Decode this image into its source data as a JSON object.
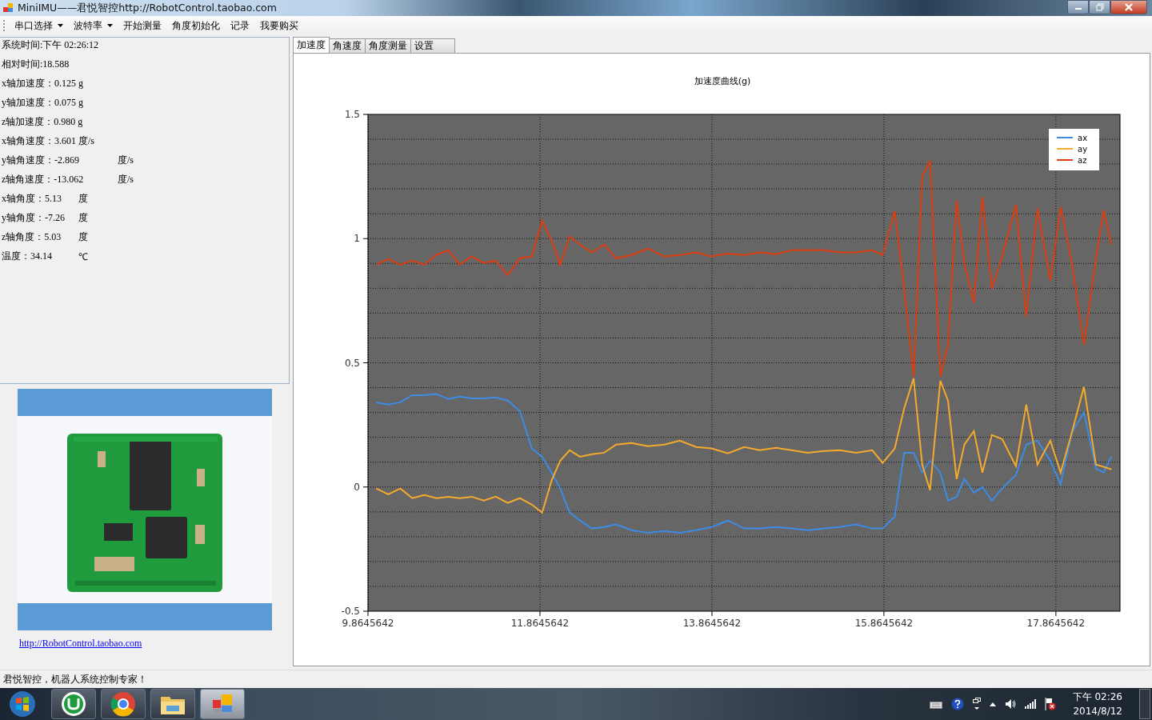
{
  "window": {
    "title": "MiniIMU——君悦智控http://RobotControl.taobao.com"
  },
  "menu": [
    {
      "label": "串口选择",
      "dropdown": true
    },
    {
      "label": "波特率",
      "dropdown": true
    },
    {
      "label": "开始测量",
      "dropdown": false
    },
    {
      "label": "角度初始化",
      "dropdown": false
    },
    {
      "label": "记录",
      "dropdown": false
    },
    {
      "label": "我要购买",
      "dropdown": false
    }
  ],
  "readings": [
    {
      "kind": "plain",
      "text": "系统时间:下午 02:26:12"
    },
    {
      "kind": "plain",
      "text": "相对时间:18.588"
    },
    {
      "kind": "plain",
      "text": "x轴加速度：0.125 g"
    },
    {
      "kind": "plain",
      "text": "y轴加速度：0.075 g"
    },
    {
      "kind": "plain",
      "text": "z轴加速度：0.980 g"
    },
    {
      "kind": "plain",
      "text": "x轴角速度：3.601 度/s"
    },
    {
      "kind": "rate",
      "text": "y轴角速度：-2.869",
      "unit": "度/s"
    },
    {
      "kind": "rate",
      "text": "z轴角速度：-13.062",
      "unit": "度/s"
    },
    {
      "kind": "angle",
      "text": "x轴角度：5.13",
      "unit": "度"
    },
    {
      "kind": "angle",
      "text": "y轴角度：-7.26",
      "unit": "度"
    },
    {
      "kind": "angle",
      "text": "z轴角度：5.03",
      "unit": "度"
    },
    {
      "kind": "angle",
      "text": "温度：34.14",
      "unit": "℃"
    }
  ],
  "link": "http://RobotControl.taobao.com",
  "tabs": [
    {
      "label": "加速度",
      "selected": true
    },
    {
      "label": "角速度",
      "selected": false
    },
    {
      "label": "角度测量",
      "selected": false
    },
    {
      "label": "设置",
      "selected": false
    }
  ],
  "chart": {
    "chart_data": {
      "type": "line",
      "title": "加速度曲线(g)",
      "grid": true,
      "legend": true,
      "xlim": [
        9.8645642,
        18.61
      ],
      "ylim": [
        -0.5,
        1.5
      ],
      "xticks": [
        {
          "value": 9.8645642,
          "label": "9.8645642"
        },
        {
          "value": 11.8645642,
          "label": "11.8645642"
        },
        {
          "value": 13.8645642,
          "label": "13.8645642"
        },
        {
          "value": 15.8645642,
          "label": "15.8645642"
        },
        {
          "value": 17.8645642,
          "label": "17.8645642"
        }
      ],
      "yticks": [
        {
          "value": 1.5,
          "label": "1.5"
        },
        {
          "value": 1,
          "label": "1"
        },
        {
          "value": 0.5,
          "label": "0.5"
        },
        {
          "value": 0,
          "label": "0"
        },
        {
          "value": -0.5,
          "label": "-0.5"
        }
      ],
      "x": [
        9.96,
        10.1,
        10.24,
        10.38,
        10.52,
        10.66,
        10.8,
        10.93,
        11.07,
        11.21,
        11.35,
        11.49,
        11.63,
        11.77,
        11.89,
        12.0,
        12.1,
        12.21,
        12.33,
        12.47,
        12.61,
        12.75,
        12.93,
        13.12,
        13.31,
        13.49,
        13.68,
        13.86,
        14.05,
        14.24,
        14.42,
        14.61,
        14.79,
        14.98,
        15.17,
        15.35,
        15.54,
        15.73,
        15.85,
        15.99,
        16.1,
        16.21,
        16.31,
        16.4,
        16.52,
        16.61,
        16.71,
        16.8,
        16.91,
        17.01,
        17.12,
        17.24,
        17.4,
        17.52,
        17.65,
        17.8,
        17.92,
        18.05,
        18.19,
        18.33,
        18.42,
        18.51
      ],
      "series": [
        {
          "name": "ax",
          "color": "#3c8ce6",
          "values": [
            0.341,
            0.332,
            0.341,
            0.37,
            0.37,
            0.374,
            0.354,
            0.364,
            0.357,
            0.357,
            0.361,
            0.348,
            0.306,
            0.155,
            0.122,
            0.058,
            -0.006,
            -0.103,
            -0.135,
            -0.167,
            -0.161,
            -0.151,
            -0.174,
            -0.184,
            -0.177,
            -0.184,
            -0.174,
            -0.161,
            -0.135,
            -0.167,
            -0.167,
            -0.161,
            -0.167,
            -0.174,
            -0.167,
            -0.161,
            -0.151,
            -0.167,
            -0.167,
            -0.119,
            0.138,
            0.138,
            0.058,
            0.106,
            0.058,
            -0.055,
            -0.039,
            0.032,
            -0.023,
            0.0,
            -0.055,
            -0.006,
            0.048,
            0.171,
            0.187,
            0.106,
            0.01,
            0.219,
            0.3,
            0.074,
            0.058,
            0.122
          ]
        },
        {
          "name": "ay",
          "color": "#f5aa2d",
          "values": [
            -0.006,
            -0.029,
            -0.006,
            -0.045,
            -0.032,
            -0.045,
            -0.039,
            -0.045,
            -0.039,
            -0.055,
            -0.039,
            -0.064,
            -0.045,
            -0.071,
            -0.103,
            0.026,
            0.106,
            0.148,
            0.122,
            0.132,
            0.138,
            0.171,
            0.177,
            0.164,
            0.171,
            0.187,
            0.161,
            0.155,
            0.135,
            0.161,
            0.148,
            0.158,
            0.148,
            0.138,
            0.145,
            0.148,
            0.138,
            0.148,
            0.097,
            0.155,
            0.316,
            0.438,
            0.09,
            -0.013,
            0.428,
            0.348,
            0.032,
            0.171,
            0.225,
            0.058,
            0.209,
            0.193,
            0.084,
            0.332,
            0.09,
            0.187,
            0.058,
            0.219,
            0.403,
            0.09,
            0.081,
            0.071
          ]
        },
        {
          "name": "az",
          "color": "#dc3c0f",
          "values": [
            0.895,
            0.918,
            0.895,
            0.911,
            0.895,
            0.934,
            0.953,
            0.895,
            0.928,
            0.902,
            0.911,
            0.853,
            0.921,
            0.928,
            1.072,
            0.992,
            0.895,
            1.008,
            0.976,
            0.944,
            0.976,
            0.921,
            0.934,
            0.96,
            0.928,
            0.934,
            0.944,
            0.928,
            0.94,
            0.934,
            0.944,
            0.937,
            0.953,
            0.953,
            0.953,
            0.944,
            0.944,
            0.953,
            0.934,
            1.111,
            0.799,
            0.444,
            1.25,
            1.314,
            0.444,
            0.573,
            1.153,
            0.902,
            0.741,
            1.169,
            0.799,
            0.928,
            1.137,
            0.686,
            1.121,
            0.831,
            1.127,
            0.902,
            0.573,
            0.918,
            1.114,
            0.976
          ]
        }
      ]
    }
  },
  "status_bar": "君悦智控，机器人系统控制专家！",
  "taskbar": {
    "clock_time": "下午 02:26",
    "clock_date": "2014/8/12"
  }
}
